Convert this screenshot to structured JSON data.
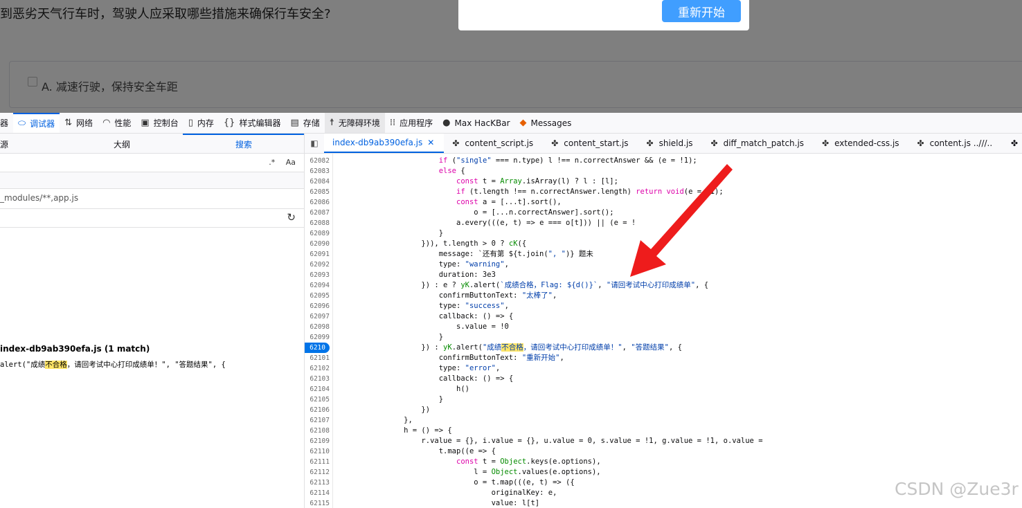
{
  "quiz": {
    "question": "到恶劣天气行车时，驾驶人应采取哪些措施来确保行车安全?",
    "option_a": "A. 减速行驶，保持安全车距",
    "dialog_button": "重新开始"
  },
  "toolbar": {
    "tabs": [
      {
        "label": "器",
        "icon": "inspector-icon"
      },
      {
        "label": "调试器",
        "icon": "debugger-icon"
      },
      {
        "label": "网络",
        "icon": "network-icon"
      },
      {
        "label": "性能",
        "icon": "performance-icon"
      },
      {
        "label": "控制台",
        "icon": "console-icon"
      },
      {
        "label": "内存",
        "icon": "memory-icon"
      },
      {
        "label": "样式编辑器",
        "icon": "style-editor-icon"
      },
      {
        "label": "存储",
        "icon": "storage-icon"
      },
      {
        "label": "无障碍环境",
        "icon": "accessibility-icon"
      },
      {
        "label": "应用程序",
        "icon": "application-icon"
      },
      {
        "label": "Max HacKBar",
        "icon": "hackbar-icon"
      },
      {
        "label": "Messages",
        "icon": "fox-icon"
      }
    ]
  },
  "left_pane": {
    "tabs": [
      "源",
      "大纲",
      "搜索"
    ],
    "search_options": [
      ".*",
      "Aa"
    ],
    "exclude_pattern": "_modules/**,app.js",
    "result_file": "index-db9ab390efa.js (1 match)",
    "result_line_pre": "alert(\"成绩",
    "result_line_match": "不合格",
    "result_line_post": "，请回考试中心打印成绩单！\", \"答题结果\", {"
  },
  "editor": {
    "tabs": [
      "index-db9ab390efa.js",
      "content_script.js",
      "content_start.js",
      "shield.js",
      "diff_match_patch.js",
      "extended-css.js",
      "content.js ..///.."
    ],
    "current_line_label": "6210",
    "line_numbers": [
      "62082",
      "62083",
      "62084",
      "62085",
      "62086",
      "62087",
      "62088",
      "62089",
      "62090",
      "62091",
      "62092",
      "62093",
      "62094",
      "62095",
      "62096",
      "62097",
      "62098",
      "62099",
      "6210",
      "62101",
      "62102",
      "62103",
      "62104",
      "62105",
      "62106",
      "62107",
      "62108",
      "62109",
      "62110",
      "62111",
      "62112",
      "62113",
      "62114",
      "62115"
    ],
    "code_lines": [
      "                        if (\"single\" === n.type) l !== n.correctAnswer && (e = !1);",
      "                        else {",
      "                            const t = Array.isArray(l) ? l : [l];",
      "                            if (t.length !== n.correctAnswer.length) return void(e = !1);",
      "                            const a = [...t].sort(),",
      "                                o = [...n.correctAnswer].sort();",
      "                            a.every(((e, t) => e === o[t])) || (e = !",
      "                        }",
      "                    })), t.length > 0 ? cK({",
      "                        message: `还有第 ${t.join(\", \")} 题未",
      "                        type: \"warning\",",
      "                        duration: 3e3",
      "                    }) : e ? yK.alert(`成绩合格，Flag: ${d()}`, \"请回考试中心打印成绩单\", {",
      "                        confirmButtonText: \"太棒了\",",
      "                        type: \"success\",",
      "                        callback: () => {",
      "                            s.value = !0",
      "                        }",
      "                    }) : yK.alert(\"成绩不合格，请回考试中心打印成绩单！\", \"答题结果\", {",
      "                        confirmButtonText: \"重新开始\",",
      "                        type: \"error\",",
      "                        callback: () => {",
      "                            h()",
      "                        }",
      "                    })",
      "                },",
      "                h = () => {",
      "                    r.value = {}, i.value = {}, u.value = 0, s.value = !1, g.value = !1, o.value =",
      "                        t.map((e => {",
      "                            const t = Object.keys(e.options),",
      "                                l = Object.values(e.options),",
      "                                o = t.map(((e, t) => ({",
      "                                    originalKey: e,",
      "                                    value: l[t]"
    ]
  },
  "watermark": "CSDN @Zue3r"
}
